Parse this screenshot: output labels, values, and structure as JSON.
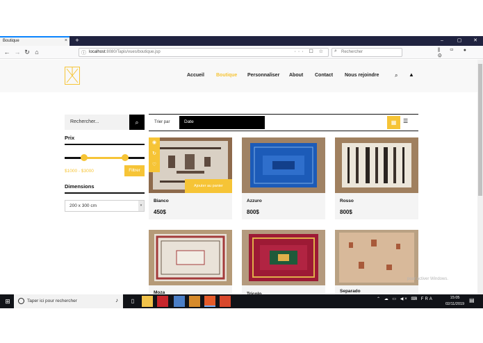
{
  "browser": {
    "tab_title": "Boutique",
    "tab_close": "×",
    "new_tab": "+",
    "win_min": "–",
    "win_max": "▢",
    "win_close": "✕",
    "back": "←",
    "forward": "→",
    "reload": "↻",
    "home": "⌂",
    "url_host": "localhost",
    "url_path": ":8080/Tapis/vues/boutique.jsp",
    "url_info": "ⓘ",
    "url_actions": "··· ☐ ☆",
    "search_placeholder": "Rechercher",
    "toolbar_icons": "⫼ ▭ ● ⚙"
  },
  "site": {
    "menu": [
      {
        "label": "Accueil",
        "active": false
      },
      {
        "label": "Boutique",
        "active": true
      },
      {
        "label": "Personnaliser",
        "active": false
      },
      {
        "label": "About",
        "active": false
      },
      {
        "label": "Contact",
        "active": false
      },
      {
        "label": "Nous rejoindre",
        "active": false
      }
    ],
    "search_icon": "⌕",
    "cart_icon": "🔒"
  },
  "sidebar": {
    "search_placeholder": "Rechercher...",
    "search_btn": "⌕",
    "price_title": "Prix",
    "price_range": "$1000 - $3000",
    "filter_label": "Filtrer",
    "dimensions_title": "Dimensions",
    "dimension_selected": "200 x 300 cm",
    "select_arrow": "▾",
    "accent": "#f6c436"
  },
  "toolbar": {
    "sort_label": "Trier par",
    "sort_selected": "Date",
    "grid_icon": "▦",
    "list_icon": "☰"
  },
  "products": [
    {
      "name": "Bianco",
      "price": "450$"
    },
    {
      "name": "Azzuro",
      "price": "800$"
    },
    {
      "name": "Rosso",
      "price": "800$"
    },
    {
      "name": "Moza",
      "price": ""
    },
    {
      "name": "Tricolo",
      "price": ""
    },
    {
      "name": "Separado",
      "price": ""
    }
  ],
  "card_actions": {
    "add_to_cart": "Ajouter au panier",
    "icon1": "◉",
    "icon2": "↻",
    "icon3": "♡"
  },
  "watermark": "pour activer Windows.",
  "taskbar": {
    "start": "⊞",
    "search_placeholder": "Taper ici pour rechercher",
    "mic": "🎙",
    "tray": "⌃ ☁ ▭ ◀× ⌨ FRA",
    "time": "15:05",
    "date": "02/11/2019",
    "notif": "▤"
  }
}
